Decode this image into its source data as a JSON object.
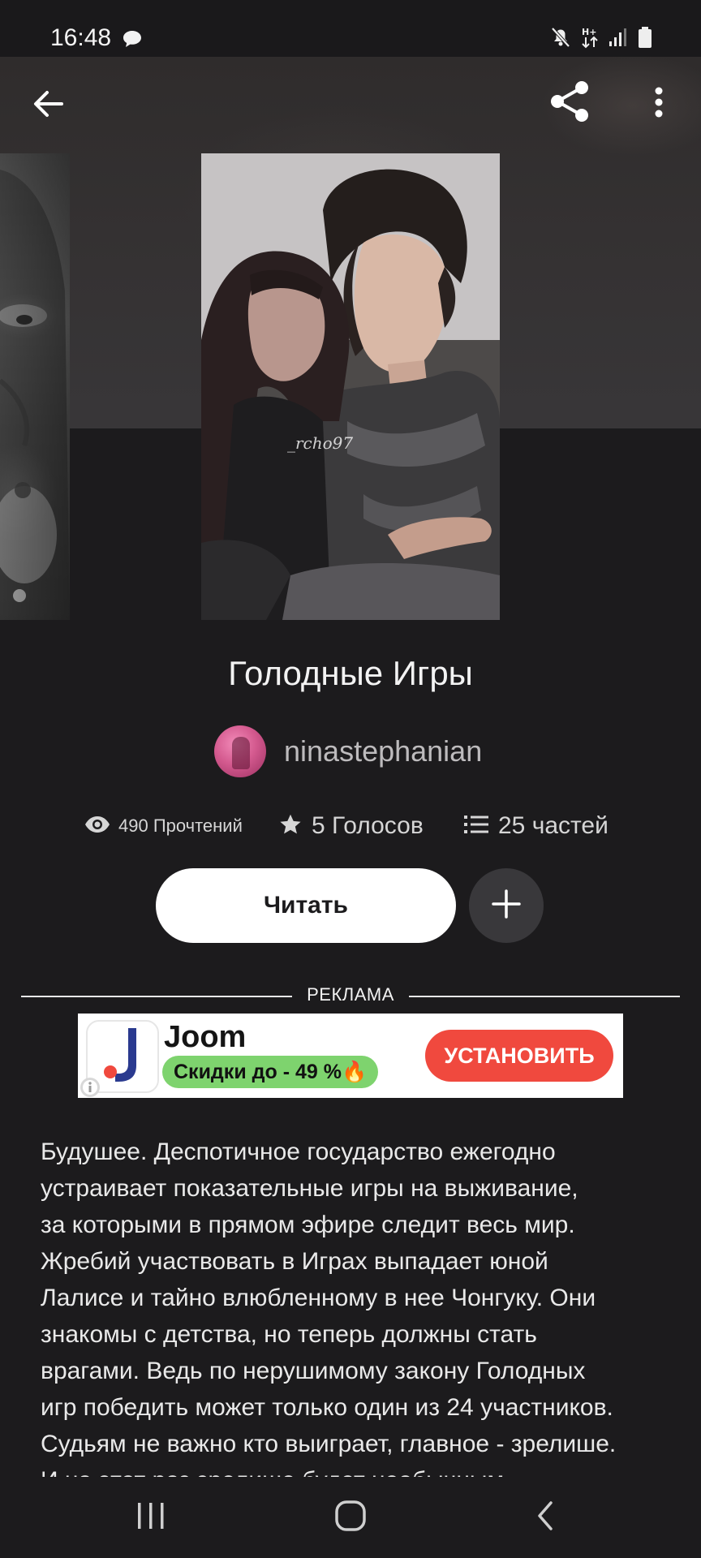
{
  "status_bar": {
    "time": "16:48"
  },
  "icons": {
    "chat": "chat-bubble-icon",
    "mute": "mute-icon",
    "data": "data-transfer-icon",
    "signal": "signal-icon",
    "battery": "battery-icon",
    "back": "arrow-left-icon",
    "share": "share-icon",
    "more": "more-vertical-icon",
    "eye": "eye-icon",
    "star": "star-icon",
    "list": "list-icon",
    "plus": "plus-icon"
  },
  "cover": {
    "watermark": "_rcho97"
  },
  "story": {
    "title": "Голодные Игры",
    "author": "ninastephanian",
    "stats": {
      "reads": "490 Прочтений",
      "votes": "5 Голосов",
      "parts": "25 частей"
    },
    "read_button": "Читать"
  },
  "ad": {
    "label": "РЕКЛАМА",
    "brand": "Joom",
    "promo": "Скидки до - 49 %🔥",
    "install_button": "УСТАНОВИТЬ",
    "colors": {
      "promo_bg": "#7ed36e",
      "install_bg": "#f0493e",
      "logo_accent": "#f0493e",
      "logo_main": "#2a3a8f"
    }
  },
  "description_lines": [
    "Будушее. Деспотичное государство ежегодно",
    "устраивает показательные игры на выживание,",
    "за которыми в прямом эфире следит весь мир.",
    "Жребий участвовать в Играх выпадает юной",
    "Лалисе и тайно влюбленному в нее Чонгуку. Они",
    "знакомы с детства, но теперь должны стать",
    "врагами. Ведь по нерушимому закону Голодных",
    "игр победить может только один из 24 участников.",
    "Судьям не важно кто выиграет, главное - зрелише.",
    "И на этот раз зрелише будет необычным..."
  ],
  "colors": {
    "background": "#1c1b1d",
    "text": "#f3f3f3",
    "muted_text": "#bdbbbd",
    "button_bg": "#ffffff",
    "add_button_bg": "#39383b",
    "avatar": "#d45a8f"
  }
}
